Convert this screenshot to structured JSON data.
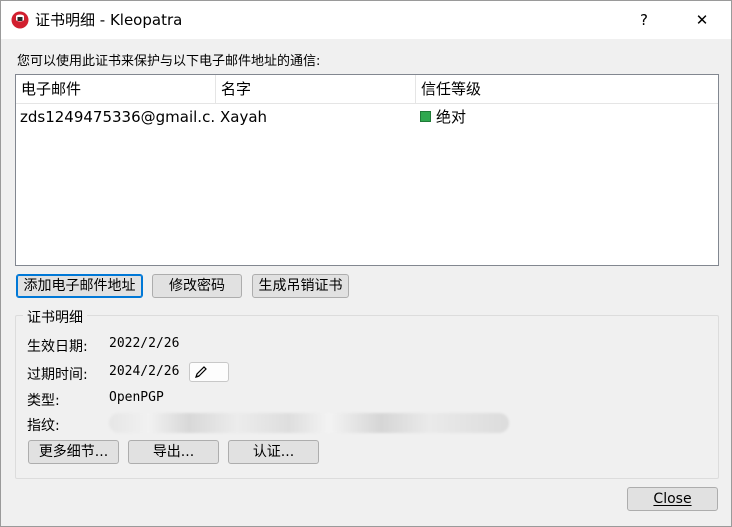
{
  "window": {
    "title": "证书明细 - Kleopatra",
    "help": "?",
    "close": "✕"
  },
  "intro": "您可以使用此证书来保护与以下电子邮件地址的通信:",
  "table": {
    "columns": [
      "电子邮件",
      "名字",
      "信任等级"
    ],
    "rows": [
      {
        "email": "zds1249475336@gmail.c...",
        "name": "Xayah",
        "trust": "绝对"
      }
    ]
  },
  "actions": {
    "add_email": "添加电子邮件地址",
    "change_password": "修改密码",
    "gen_revocation": "生成吊销证书"
  },
  "details": {
    "group_title": "证书明细",
    "valid_from_label": "生效日期:",
    "valid_from": "2022/2/26",
    "expires_label": "过期时间:",
    "expires": "2024/2/26",
    "type_label": "类型:",
    "type": "OpenPGP",
    "fingerprint_label": "指纹:",
    "more_details": "更多细节...",
    "export": "导出...",
    "certify": "认证..."
  },
  "footer": {
    "close": "Close"
  },
  "colors": {
    "accent": "#0078d7",
    "trust_ok": "#2fa84f",
    "app_icon": "#d11f2f"
  }
}
